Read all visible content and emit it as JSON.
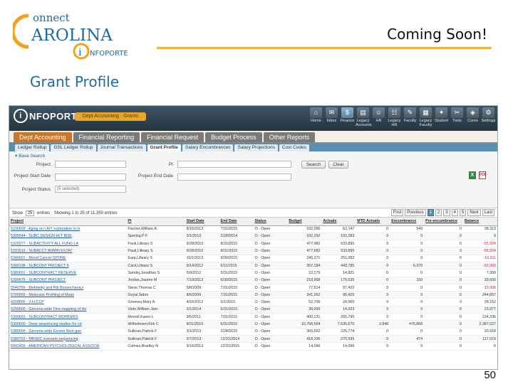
{
  "slide": {
    "logo_top": "onnect",
    "logo_main": "AROLINA",
    "logo_sub": "NFOPORTE",
    "coming_soon": "Coming Soon!",
    "section_title": "Grant Profile",
    "page_number": "50",
    "colors": {
      "rule": "#f5b23a",
      "title": "#1e6aa4"
    }
  },
  "app": {
    "logo_text": "NFOPORTE",
    "logo_mark": "i",
    "header_pill": "Dept Accounting · Grants",
    "nav": [
      {
        "label": "Home",
        "icon": "home-icon",
        "glyph": "⌂"
      },
      {
        "label": "Inbox",
        "icon": "inbox-icon",
        "glyph": "✉"
      },
      {
        "label": "Finance",
        "icon": "dollar-icon",
        "glyph": "$",
        "active": true
      },
      {
        "label": "Legacy Accounts",
        "icon": "legacy-accounts-icon",
        "glyph": "▤"
      },
      {
        "label": "HR",
        "icon": "hr-icon",
        "glyph": "☺"
      },
      {
        "label": "Legacy HR",
        "icon": "legacy-hr-icon",
        "glyph": "☷"
      },
      {
        "label": "Faculty",
        "icon": "faculty-icon",
        "glyph": "✎"
      },
      {
        "label": "Legacy Faculty",
        "icon": "legacy-faculty-icon",
        "glyph": "▦"
      },
      {
        "label": "Student",
        "icon": "student-icon",
        "glyph": "✦"
      },
      {
        "label": "Tools",
        "icon": "tools-icon",
        "glyph": "✂"
      },
      {
        "label": "Cores",
        "icon": "cores-icon",
        "glyph": "◈"
      },
      {
        "label": "Settings",
        "icon": "settings-icon",
        "glyph": "⚙"
      }
    ],
    "main_tabs": [
      "Dept Accounting",
      "Financial Reporting",
      "Financial Request",
      "Budget Process",
      "Other Reports"
    ],
    "sub_tabs": [
      "Ledger Rollup",
      "GSL Ledger Rollup",
      "Journal Transactions",
      "Grant Profile",
      "Salary Encumbrances",
      "Salary Projections",
      "Cost Codes"
    ],
    "search": {
      "base_search": "Base Search",
      "project_label": "Project",
      "pi_label": "PI",
      "project_start_label": "Project Start Date",
      "project_end_label": "Project End Date",
      "project_status_label": "Project Status",
      "project_status_value": "(5 selected)",
      "search_button": "Search",
      "clear_button": "Clear"
    },
    "pager": {
      "show_label": "Show",
      "show_value": "25",
      "entries_label": "entries",
      "showing": "Showing 1 to 25 of 11,350 entries",
      "pages": [
        "First",
        "Previous",
        "1",
        "2",
        "3",
        "4",
        "5",
        "Next",
        "Last"
      ],
      "active_page": "1"
    },
    "table": {
      "columns": [
        "Project",
        "PI",
        "Start Date",
        "End Date",
        "Status",
        "Budget",
        "Actuals",
        "MTD Actuals",
        "Encumbrance",
        "Pre-encumbrance",
        "Balance"
      ],
      "rows": [
        [
          "5230603 - Aging on LA/Y exploration in Is",
          "Fischer,William A.",
          "8/15/2013",
          "7/31/2015",
          "O - Open",
          "102,096",
          "63,147",
          "0",
          "549",
          "0",
          "38,313"
        ],
        [
          "5300544 - SUBC DESIGN-HLT BGE",
          "Spering,P F",
          "3/1/2013",
          "2/28/2014",
          "O - Open",
          "102,292",
          "102,283",
          "0",
          "0",
          "0",
          "9"
        ],
        [
          "5320277 - SUBACTIVITY-ALL FUNG LA",
          "Pauli,Lilleary S",
          "9/28/2010",
          "8/31/2015",
          "O - Open",
          "477,982",
          "633,895",
          "0",
          "0",
          "0",
          "-55,924"
        ],
        [
          "5331619 - SUBACCT ADMIN ESTAT",
          "Pauli,Lilleary S",
          "9/28/2010",
          "8/31/2015",
          "O - Open",
          "477,982",
          "533,895",
          "0",
          "0",
          "0",
          "-55,924"
        ],
        [
          "5346601 - Blood Cancer SPORE",
          "Earp,Lilleary S",
          "10/1/2013",
          "9/30/2015",
          "O - Open",
          "240,271",
          "251,082",
          "0",
          "0",
          "0",
          "-10,311"
        ],
        [
          "5390198 - SUBCONT PROJECT 5",
          "Card,Lilleary S",
          "9/14/2012",
          "6/11/2015",
          "O - Open",
          "357,184",
          "443,785",
          "0",
          "6,370",
          "0",
          "-92,993"
        ],
        [
          "5380601 - SUBCONTRACT RESERVE",
          "Sandoj,Jonathan S",
          "5/9/2012",
          "5/31/2015",
          "O - Open",
          "22,179",
          "14,821",
          "0",
          "0",
          "0",
          "7,358"
        ],
        [
          "5390675 - SUBCONT PROJECT",
          "Jordan,Joanne M",
          "7/19/2013",
          "6/30/2015",
          "O - Open",
          "218,968",
          "179,535",
          "0",
          "150",
          "0",
          "39,650"
        ],
        [
          "5540756 - Biofidelity and Rib Biomechanics",
          "Steve,Thomas C",
          "5/8/2009",
          "7/31/2015",
          "O - Open",
          "77,514",
          "97,422",
          "0",
          "0",
          "0",
          "-19,908"
        ],
        [
          "5700655 - Molecular Profiling of Mass",
          "Goyal,Sidon",
          "8/6/2009",
          "7/31/2015",
          "O - Open",
          "341,262",
          "95,605",
          "0",
          "0",
          "0",
          "244,657"
        ],
        [
          "4208800 - 2-H-CCP",
          "Greeney,Mary A",
          "4/16/2012",
          "6/1/2015",
          "O - Open",
          "52,706",
          "24,065",
          "0",
          "0",
          "0",
          "28,152"
        ],
        [
          "5299500 - Genome-wide Fine-mapping of He",
          "Viele,William Jam",
          "2/1/2014",
          "5/31/2015",
          "O - Open",
          "38,000",
          "14,023",
          "0",
          "0",
          "0",
          "23,977"
        ],
        [
          "5300663 - SUBCONTRACT WORKERS",
          "Morrell,Karen L",
          "9/5/2011",
          "7/31/2015",
          "O - Open",
          "400,131",
          "265,795",
          "0",
          "0",
          "0",
          "134,336"
        ],
        [
          "5300600 - Deep sequencing studies for cd",
          "Wilhelmsen,Kirk C",
          "8/31/2010",
          "6/31/2015",
          "O - Open",
          "10,768,564",
          "7,635,670",
          "2,848",
          "475,868",
          "0",
          "2,387,027"
        ],
        [
          "5380004 - Genome-wide Exome Next-gen",
          "Sullivan,Patrick F",
          "3/1/2013",
          "2/28/2015",
          "O - Open",
          "360,692",
          "225,774",
          "0",
          "0",
          "0",
          "20,918"
        ],
        [
          "5380701 - MRSEC scenario sequencing",
          "Sullivan,Patrick F",
          "2/7/2013",
          "12/31/2014",
          "O - Open",
          "418,106",
          "270,595",
          "0",
          "474",
          "0",
          "117,019"
        ],
        [
          "5042459 - AMERICAN PSYCHOLOGICAL ASSOCIA",
          "Colmes,Bradley N",
          "9/16/2013",
          "12/31/2015",
          "O - Open",
          "14,096",
          "14,096",
          "0",
          "0",
          "0",
          "0"
        ]
      ]
    }
  }
}
